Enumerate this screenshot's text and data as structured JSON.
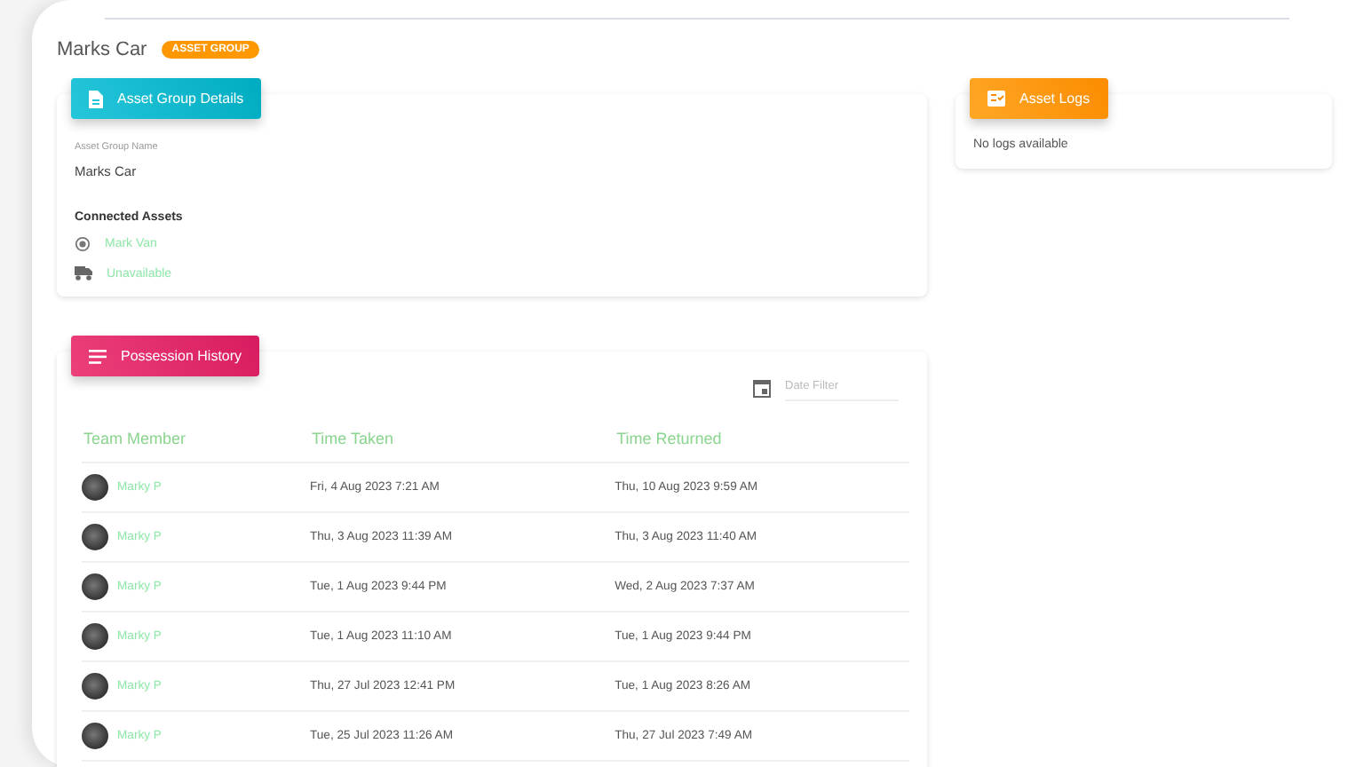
{
  "header": {
    "title": "Marks Car",
    "badge": "ASSET GROUP"
  },
  "details": {
    "tab": "Asset Group Details",
    "field_label": "Asset Group Name",
    "field_value": "Marks Car",
    "connected_title": "Connected Assets",
    "assets": [
      {
        "kind": "tracker",
        "label": "Mark Van"
      },
      {
        "kind": "truck",
        "label": "Unavailable"
      }
    ]
  },
  "logs": {
    "tab": "Asset Logs",
    "message": "No logs available"
  },
  "history": {
    "tab": "Possession History",
    "date_filter": {
      "placeholder": "Date Filter"
    },
    "columns": [
      "Team Member",
      "Time Taken",
      "Time Returned"
    ],
    "rows": [
      {
        "member": "Marky P",
        "taken": "Fri, 4 Aug 2023 7:21 AM",
        "returned": "Thu, 10 Aug 2023 9:59 AM"
      },
      {
        "member": "Marky P",
        "taken": "Thu, 3 Aug 2023 11:39 AM",
        "returned": "Thu, 3 Aug 2023 11:40 AM"
      },
      {
        "member": "Marky P",
        "taken": "Tue, 1 Aug 2023 9:44 PM",
        "returned": "Wed, 2 Aug 2023 7:37 AM"
      },
      {
        "member": "Marky P",
        "taken": "Tue, 1 Aug 2023 11:10 AM",
        "returned": "Tue, 1 Aug 2023 9:44 PM"
      },
      {
        "member": "Marky P",
        "taken": "Thu, 27 Jul 2023 12:41 PM",
        "returned": "Tue, 1 Aug 2023 8:26 AM"
      },
      {
        "member": "Marky P",
        "taken": "Tue, 25 Jul 2023 11:26 AM",
        "returned": "Thu, 27 Jul 2023 7:49 AM"
      }
    ]
  }
}
